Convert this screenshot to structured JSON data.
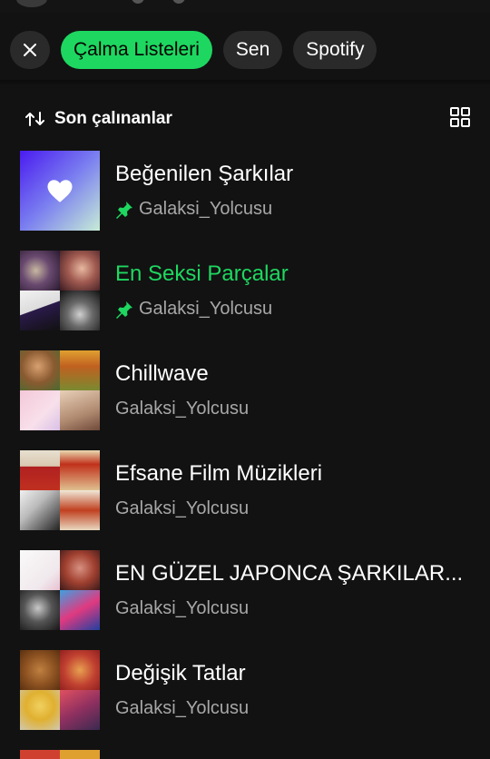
{
  "filters": {
    "close_icon": "close-icon",
    "chips": [
      "Çalma Listeleri",
      "Sen",
      "Spotify"
    ]
  },
  "sort": {
    "icon": "sort-arrows-icon",
    "label": "Son çalınanlar",
    "view_icon": "grid-view-icon"
  },
  "playlists": [
    {
      "title": "Beğenilen Şarkılar",
      "owner": "Galaksi_Yolcusu",
      "pinned": true,
      "playing": false
    },
    {
      "title": "En Seksi Parçalar",
      "owner": "Galaksi_Yolcusu",
      "pinned": true,
      "playing": true
    },
    {
      "title": "Chillwave",
      "owner": "Galaksi_Yolcusu",
      "pinned": false,
      "playing": false
    },
    {
      "title": "Efsane Film Müzikleri",
      "owner": "Galaksi_Yolcusu",
      "pinned": false,
      "playing": false
    },
    {
      "title": "EN GÜZEL JAPONCA ŞARKILAR...",
      "owner": "Galaksi_Yolcusu",
      "pinned": false,
      "playing": false
    },
    {
      "title": "Değişik Tatlar",
      "owner": "Galaksi_Yolcusu",
      "pinned": false,
      "playing": false
    }
  ],
  "colors": {
    "background": "#121212",
    "accent": "#1ed760",
    "chip": "#2a2a2a",
    "secondary_text": "#a7a7a7"
  }
}
